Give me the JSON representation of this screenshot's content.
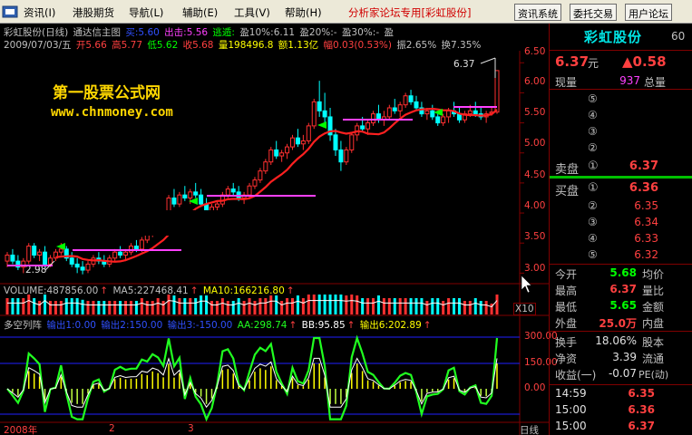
{
  "menu": {
    "items": [
      "资讯(I)",
      "港股期货",
      "导航(L)",
      "辅助(E)",
      "工具(V)",
      "帮助(H)"
    ],
    "brand": "分析家论坛专用[彩虹股份]",
    "buttons": [
      "资讯系统",
      "委托交易",
      "用户论坛"
    ]
  },
  "chart_header": {
    "title": "彩虹股份(日线)",
    "indicator": "通达信主图",
    "buy_label": "买:5.60",
    "sell_label": "出击:5.56",
    "escape_label": "逃遁:",
    "profit_items": [
      "盈10%:6.11",
      "盈20%:-",
      "盈30%:-",
      "盈"
    ]
  },
  "ohlc": {
    "date": "2009/07/03/五",
    "open": "开5.66",
    "high": "高5.77",
    "low": "低5.62",
    "close": "收5.68",
    "volume": "量198496.8",
    "amount": "额1.13亿",
    "change": "幅0.03(0.53%)",
    "amplitude": "振2.65%",
    "turnover": "换7.35%"
  },
  "watermark": {
    "line1": "第一股票公式网",
    "line2": "www.chnmoney.com"
  },
  "price_annotations": {
    "high_marker": "6.37",
    "low_marker": "2.98"
  },
  "price_axis": [
    "6.50",
    "6.00",
    "5.50",
    "5.00",
    "4.50",
    "4.00",
    "3.50",
    "3.00"
  ],
  "volume_header": {
    "volume": "VOLUME:487856.00",
    "ma5": "MA5:227468.41",
    "ma10": "MA10:166216.80",
    "unit": "X10"
  },
  "indicator_header": {
    "name": "多空列阵",
    "items": [
      "输出1:0.00",
      "输出2:150.00",
      "输出3:-150.00",
      "AA:298.74",
      "BB:95.85",
      "输出6:202.89"
    ]
  },
  "indicator_axis": [
    "300.00",
    "150.00",
    "0.00"
  ],
  "date_axis": {
    "labels": [
      "2008年",
      "2",
      "3"
    ],
    "period": "日线"
  },
  "right_panel": {
    "name": "彩虹股份",
    "code": "60",
    "price": "6.37",
    "price_unit": "元",
    "change": "▲0.58",
    "current_volume_label": "现量",
    "current_volume": "937",
    "total_volume_label": "总量",
    "sell_label": "卖盘",
    "buy_label": "买盘",
    "sell_levels": [
      {
        "label": "⑤",
        "price": "",
        "vol": ""
      },
      {
        "label": "④",
        "price": "",
        "vol": ""
      },
      {
        "label": "③",
        "price": "",
        "vol": ""
      },
      {
        "label": "②",
        "price": "",
        "vol": ""
      },
      {
        "label": "①",
        "price": "6.37",
        "vol": ""
      }
    ],
    "buy_levels": [
      {
        "label": "①",
        "price": "6.36",
        "vol": ""
      },
      {
        "label": "②",
        "price": "6.35",
        "vol": ""
      },
      {
        "label": "③",
        "price": "6.34",
        "vol": ""
      },
      {
        "label": "④",
        "price": "6.33",
        "vol": ""
      },
      {
        "label": "⑤",
        "price": "6.32",
        "vol": ""
      }
    ],
    "stats": [
      {
        "l1": "今开",
        "v1": "5.68",
        "c1": "#00ff00",
        "l2": "均价"
      },
      {
        "l1": "最高",
        "v1": "6.37",
        "c1": "#ff4040",
        "l2": "量比"
      },
      {
        "l1": "最低",
        "v1": "5.65",
        "c1": "#00ff00",
        "l2": "金额"
      },
      {
        "l1": "外盘",
        "v1": "25.0万",
        "c1": "#ff4040",
        "l2": "内盘"
      }
    ],
    "finance": [
      {
        "l1": "换手",
        "v1": "18.06%",
        "l2": "股本"
      },
      {
        "l1": "净资",
        "v1": "3.39",
        "l2": "流通"
      },
      {
        "l1": "收益(一)",
        "v1": "-0.07",
        "l2": "PE(动)"
      }
    ],
    "ticks": [
      {
        "time": "14:59",
        "price": "6.35"
      },
      {
        "time": "15:00",
        "price": "6.36"
      },
      {
        "time": "15:00",
        "price": "6.37"
      }
    ]
  },
  "chart_data": {
    "type": "candlestick",
    "price_range": [
      2.9,
      6.7
    ],
    "candles": [
      [
        3.2,
        3.35,
        3.1,
        3.3
      ],
      [
        3.3,
        3.4,
        3.15,
        3.2
      ],
      [
        3.2,
        3.3,
        3.05,
        3.1
      ],
      [
        3.1,
        3.25,
        3.0,
        3.2
      ],
      [
        3.2,
        3.5,
        3.15,
        3.45
      ],
      [
        3.45,
        3.5,
        3.25,
        3.3
      ],
      [
        3.3,
        3.4,
        3.2,
        3.35
      ],
      [
        3.35,
        3.45,
        3.1,
        3.15
      ],
      [
        3.15,
        3.3,
        3.1,
        3.25
      ],
      [
        3.25,
        3.4,
        3.2,
        3.35
      ],
      [
        3.35,
        3.5,
        3.3,
        3.4
      ],
      [
        3.4,
        3.45,
        3.2,
        3.25
      ],
      [
        3.25,
        3.35,
        3.1,
        3.15
      ],
      [
        3.15,
        3.25,
        3.0,
        3.1
      ],
      [
        3.1,
        3.2,
        2.98,
        3.05
      ],
      [
        3.05,
        3.2,
        3.0,
        3.15
      ],
      [
        3.15,
        3.3,
        3.1,
        3.25
      ],
      [
        3.25,
        3.35,
        3.15,
        3.2
      ],
      [
        3.2,
        3.3,
        3.1,
        3.15
      ],
      [
        3.15,
        3.3,
        3.1,
        3.25
      ],
      [
        3.25,
        3.4,
        3.2,
        3.35
      ],
      [
        3.35,
        3.45,
        3.25,
        3.3
      ],
      [
        3.3,
        3.4,
        3.2,
        3.35
      ],
      [
        3.35,
        3.5,
        3.3,
        3.45
      ],
      [
        3.45,
        3.55,
        3.35,
        3.4
      ],
      [
        3.4,
        3.6,
        3.35,
        3.55
      ],
      [
        3.55,
        3.7,
        3.5,
        3.65
      ],
      [
        3.65,
        3.8,
        3.6,
        3.7
      ],
      [
        3.7,
        3.9,
        3.65,
        3.85
      ],
      [
        3.85,
        4.0,
        3.8,
        3.9
      ],
      [
        3.9,
        4.3,
        3.85,
        4.25
      ],
      [
        4.25,
        4.4,
        4.1,
        4.15
      ],
      [
        4.15,
        4.35,
        4.1,
        4.3
      ],
      [
        4.3,
        4.45,
        4.2,
        4.25
      ],
      [
        4.25,
        4.4,
        4.15,
        4.35
      ],
      [
        4.35,
        4.5,
        4.25,
        4.3
      ],
      [
        4.3,
        4.4,
        4.1,
        4.15
      ],
      [
        4.15,
        4.25,
        3.95,
        4.0
      ],
      [
        4.0,
        4.15,
        3.95,
        4.1
      ],
      [
        4.1,
        4.2,
        4.0,
        4.15
      ],
      [
        4.15,
        4.35,
        4.1,
        4.3
      ],
      [
        4.3,
        4.45,
        4.25,
        4.4
      ],
      [
        4.4,
        4.5,
        4.3,
        4.35
      ],
      [
        4.35,
        4.45,
        4.2,
        4.25
      ],
      [
        4.25,
        4.35,
        4.15,
        4.3
      ],
      [
        4.3,
        4.5,
        4.25,
        4.45
      ],
      [
        4.45,
        4.6,
        4.4,
        4.55
      ],
      [
        4.55,
        4.75,
        4.5,
        4.7
      ],
      [
        4.7,
        4.9,
        4.65,
        4.85
      ],
      [
        4.85,
        5.1,
        4.8,
        5.05
      ],
      [
        5.05,
        5.2,
        4.9,
        4.95
      ],
      [
        4.95,
        5.05,
        4.85,
        5.0
      ],
      [
        5.0,
        5.15,
        4.9,
        5.1
      ],
      [
        5.1,
        5.3,
        5.05,
        5.25
      ],
      [
        5.25,
        5.4,
        5.1,
        5.15
      ],
      [
        5.15,
        5.3,
        5.05,
        5.2
      ],
      [
        5.2,
        5.5,
        5.15,
        5.45
      ],
      [
        5.45,
        5.9,
        5.4,
        5.85
      ],
      [
        5.85,
        6.2,
        5.6,
        5.7
      ],
      [
        5.7,
        6.0,
        5.5,
        5.6
      ],
      [
        5.6,
        5.75,
        5.2,
        5.3
      ],
      [
        5.3,
        5.4,
        4.95,
        5.05
      ],
      [
        5.05,
        5.2,
        4.7,
        4.85
      ],
      [
        4.85,
        5.1,
        4.8,
        5.05
      ],
      [
        5.05,
        5.35,
        5.0,
        5.3
      ],
      [
        5.3,
        5.5,
        5.2,
        5.45
      ],
      [
        5.45,
        5.6,
        5.35,
        5.4
      ],
      [
        5.4,
        5.55,
        5.3,
        5.5
      ],
      [
        5.5,
        5.7,
        5.45,
        5.65
      ],
      [
        5.65,
        5.8,
        5.5,
        5.55
      ],
      [
        5.55,
        5.7,
        5.45,
        5.6
      ],
      [
        5.6,
        5.8,
        5.55,
        5.75
      ],
      [
        5.75,
        5.9,
        5.65,
        5.7
      ],
      [
        5.7,
        5.85,
        5.6,
        5.8
      ],
      [
        5.8,
        6.0,
        5.75,
        5.95
      ],
      [
        5.95,
        6.05,
        5.8,
        5.85
      ],
      [
        5.85,
        5.95,
        5.7,
        5.75
      ],
      [
        5.75,
        5.85,
        5.6,
        5.65
      ],
      [
        5.65,
        5.75,
        5.55,
        5.7
      ],
      [
        5.7,
        5.8,
        5.55,
        5.6
      ],
      [
        5.6,
        5.7,
        5.45,
        5.5
      ],
      [
        5.5,
        5.65,
        5.45,
        5.6
      ],
      [
        5.6,
        5.75,
        5.5,
        5.7
      ],
      [
        5.7,
        5.85,
        5.6,
        5.65
      ],
      [
        5.65,
        5.75,
        5.5,
        5.55
      ],
      [
        5.55,
        5.7,
        5.5,
        5.65
      ],
      [
        5.65,
        5.8,
        5.6,
        5.7
      ],
      [
        5.7,
        5.85,
        5.6,
        5.65
      ],
      [
        5.65,
        5.75,
        5.55,
        5.6
      ],
      [
        5.6,
        5.7,
        5.5,
        5.65
      ],
      [
        5.66,
        5.77,
        5.62,
        5.68
      ],
      [
        5.68,
        6.37,
        5.65,
        6.37
      ]
    ]
  }
}
